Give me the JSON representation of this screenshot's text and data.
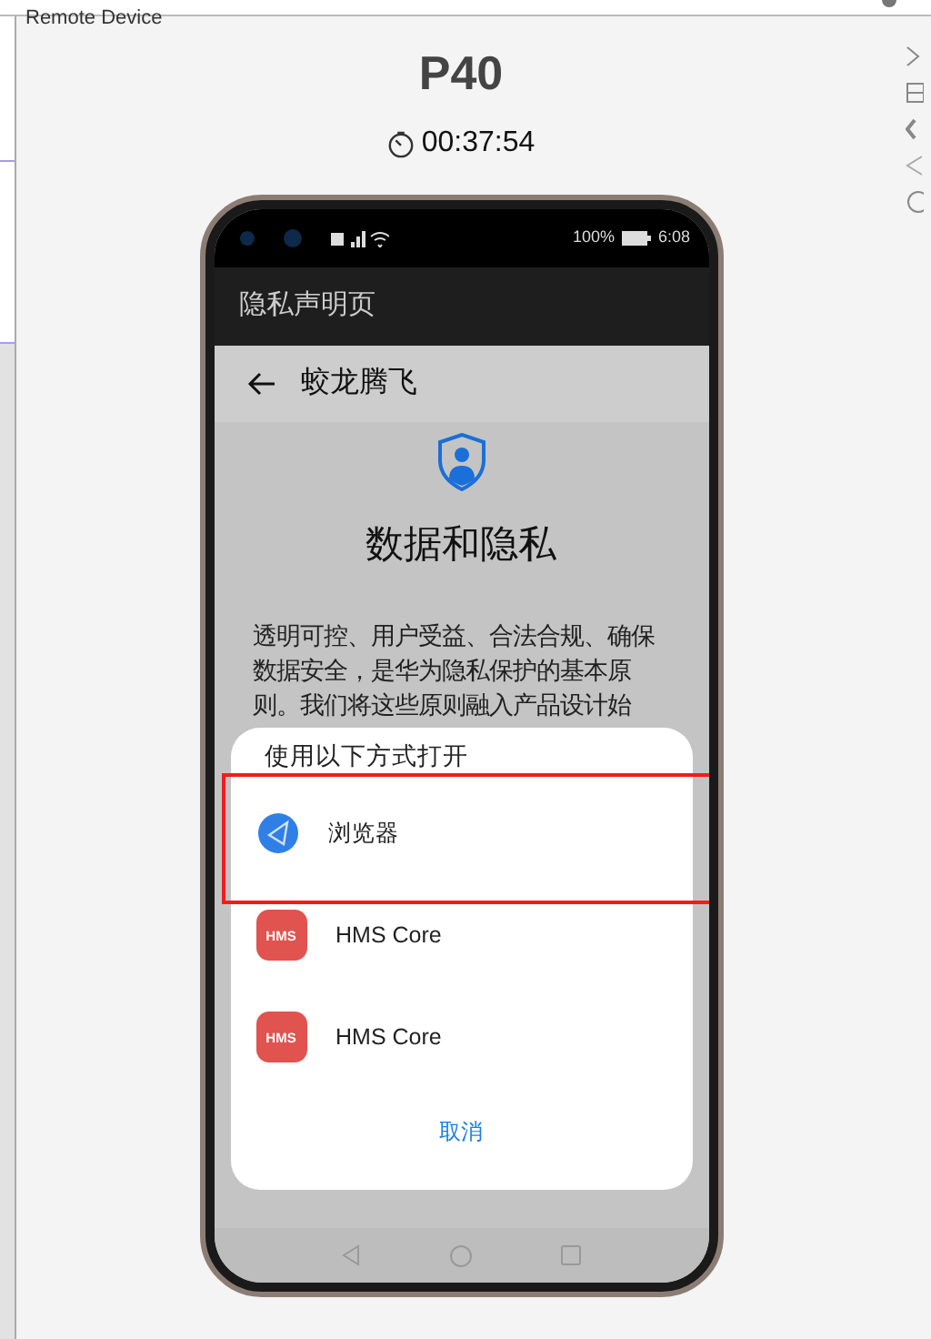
{
  "window": {
    "title": "Remote Device"
  },
  "device": {
    "name": "P40",
    "timer": "00:37:54"
  },
  "phone": {
    "status_bar": {
      "battery": "100%",
      "time": "6:08"
    },
    "app_bar_title": "隐私声明页",
    "page": {
      "title": "蛟龙腾飞",
      "heading": "数据和隐私",
      "body": "透明可控、用户受益、合法合规、确保数据安全，是华为隐私保护的基本原则。我们将这些原则融入产品设计始"
    },
    "chooser": {
      "title": "使用以下方式打开",
      "options": [
        {
          "label": "浏览器",
          "kind": "browser",
          "highlighted": true
        },
        {
          "label": "HMS Core",
          "kind": "hms",
          "icon_text": "HMS",
          "highlighted": false
        },
        {
          "label": "HMS Core",
          "kind": "hms",
          "icon_text": "HMS",
          "highlighted": false
        }
      ],
      "cancel": "取消"
    }
  }
}
